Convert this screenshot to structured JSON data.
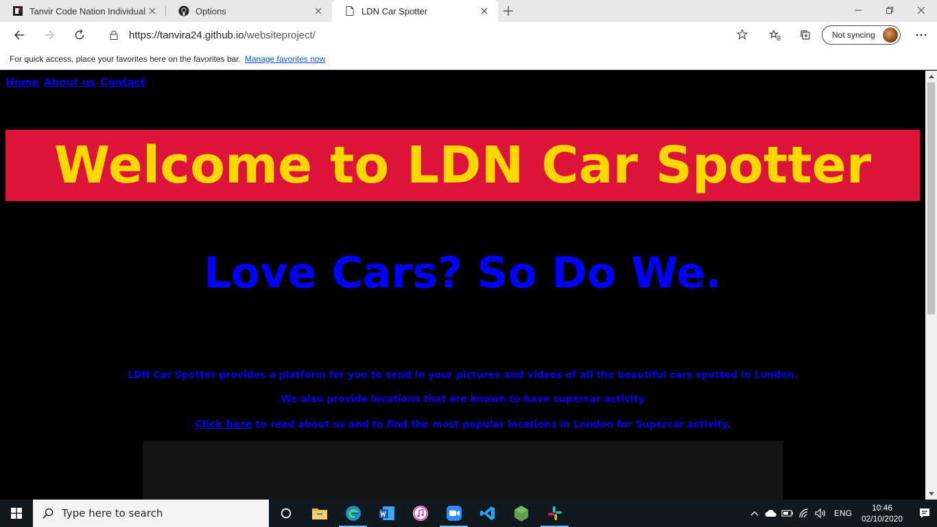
{
  "browser": {
    "tabs": [
      {
        "title": "Tanvir Code Nation Individual Ta",
        "icon": "codenation-favicon-icon",
        "active": false
      },
      {
        "title": "Options",
        "icon": "github-icon",
        "active": false
      },
      {
        "title": "LDN Car Spotter",
        "icon": "page-icon",
        "active": true
      }
    ],
    "url_host": "https://tanvira24.github.io",
    "url_path": "/websiteproject/",
    "sync_label": "Not syncing",
    "favorites_bar_text": "For quick access, place your favorites here on the favorites bar.",
    "favorites_bar_link": "Manage favorites now"
  },
  "page": {
    "nav": [
      "Home",
      "About us",
      "Contact"
    ],
    "hero_title": "Welcome to LDN Car Spotter",
    "tagline": "Love Cars? So Do We.",
    "para1": "LDN Car Spotter provides a platform for you to send in your pictures and videos of all the beautiful cars spotted in London.",
    "para2": "We also provide locations that are known to have supercar activity",
    "para3_link": "Click here",
    "para3_rest": " to read about us and to find the most popular locations in London for Supercar activity.",
    "colors": {
      "hero_bg": "#dc143c",
      "hero_text": "#ffd700",
      "blue_text": "#0000ff",
      "page_bg": "#000000"
    }
  },
  "taskbar": {
    "search_placeholder": "Type here to search",
    "apps": [
      "cortana-icon",
      "file-explorer-icon",
      "edge-icon",
      "word-icon",
      "itunes-icon",
      "zoom-icon",
      "vscode-icon",
      "nodejs-icon",
      "slack-icon"
    ],
    "language": "ENG",
    "time": "10:46",
    "date": "02/10/2020"
  }
}
